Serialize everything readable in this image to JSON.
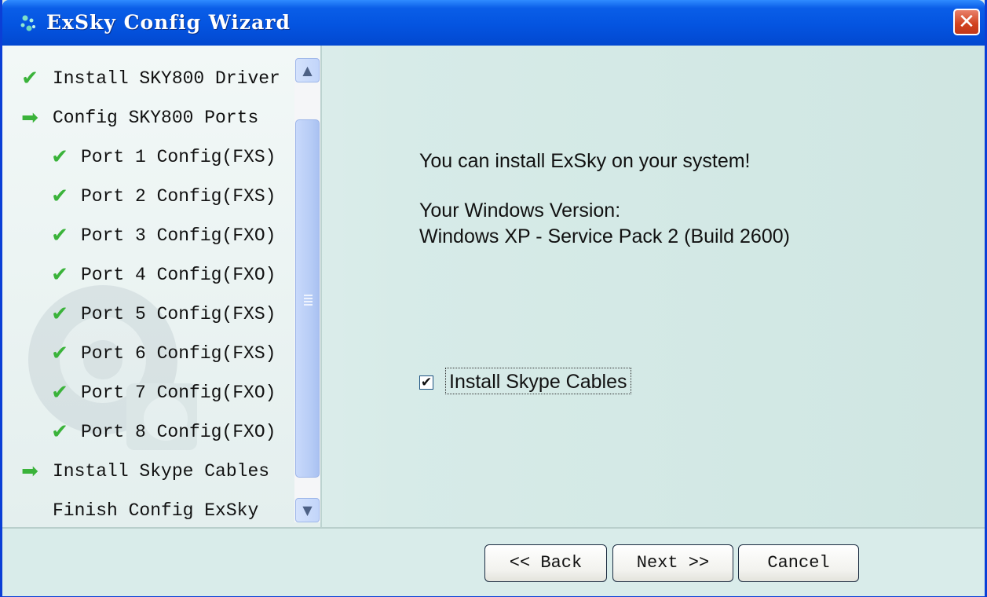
{
  "window": {
    "title": "ExSky Config Wizard",
    "close_glyph": "✕"
  },
  "steps": [
    {
      "label": "Install SKY800 Driver",
      "icon": "check-icon",
      "glyph": "✔",
      "indent": false
    },
    {
      "label": "Config SKY800 Ports",
      "icon": "arrow-right-icon",
      "glyph": "➡",
      "indent": false
    },
    {
      "label": "Port 1 Config(FXS)",
      "icon": "check-icon",
      "glyph": "✔",
      "indent": true
    },
    {
      "label": "Port 2 Config(FXS)",
      "icon": "check-icon",
      "glyph": "✔",
      "indent": true
    },
    {
      "label": "Port 3 Config(FXO)",
      "icon": "check-icon",
      "glyph": "✔",
      "indent": true
    },
    {
      "label": "Port 4 Config(FXO)",
      "icon": "check-icon",
      "glyph": "✔",
      "indent": true
    },
    {
      "label": "Port 5 Config(FXS)",
      "icon": "check-icon",
      "glyph": "✔",
      "indent": true
    },
    {
      "label": "Port 6 Config(FXS)",
      "icon": "check-icon",
      "glyph": "✔",
      "indent": true
    },
    {
      "label": "Port 7 Config(FXO)",
      "icon": "check-icon",
      "glyph": "✔",
      "indent": true
    },
    {
      "label": "Port 8 Config(FXO)",
      "icon": "check-icon",
      "glyph": "✔",
      "indent": true
    },
    {
      "label": "Install Skype Cables",
      "icon": "arrow-right-icon",
      "glyph": "➡",
      "indent": false
    },
    {
      "label": "Finish Config ExSky",
      "icon": "",
      "glyph": "",
      "indent": false
    }
  ],
  "scrollbar": {
    "up_glyph": "▲",
    "down_glyph": "▼"
  },
  "main": {
    "line1": "You can install ExSky on your system!",
    "line2": "Your Windows Version:",
    "line3": "Windows XP - Service Pack 2 (Build 2600)",
    "checkbox_label": "Install Skype Cables",
    "checkbox_checked": true,
    "checkbox_glyph": "✔"
  },
  "buttons": {
    "back": "<< Back",
    "next": "Next >>",
    "cancel": "Cancel"
  }
}
